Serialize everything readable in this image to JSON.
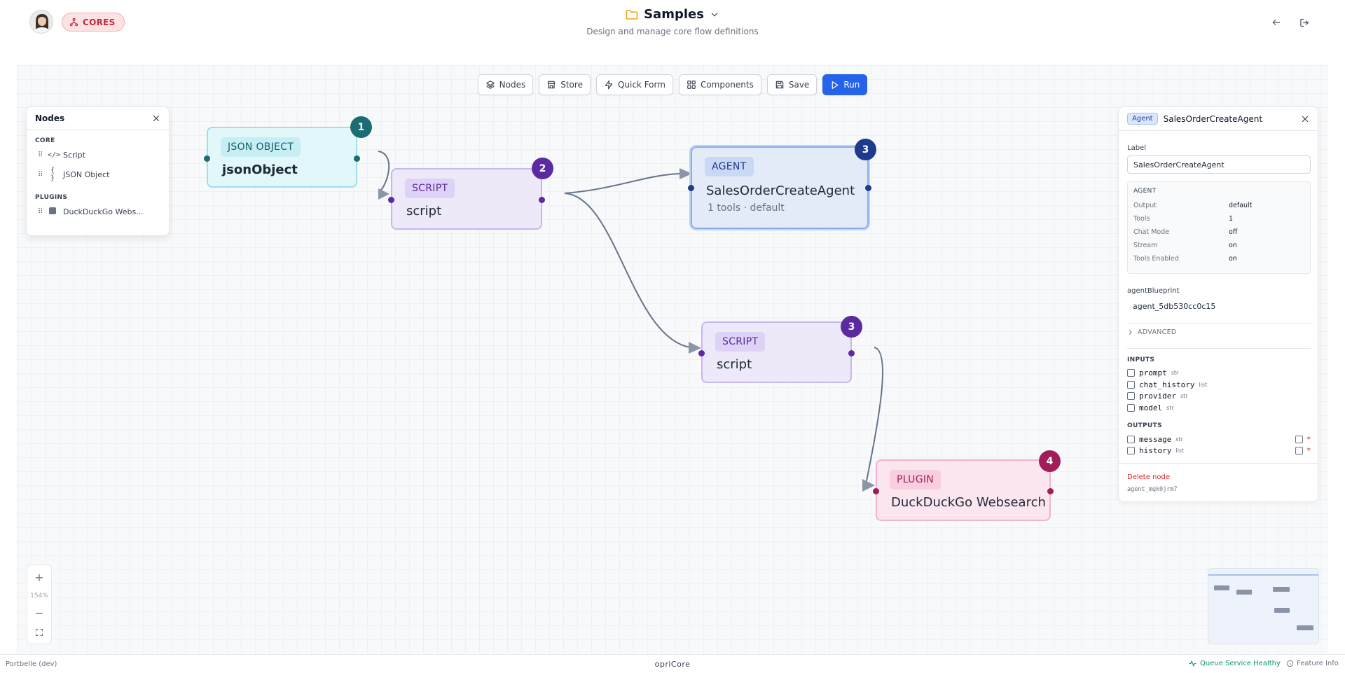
{
  "header": {
    "badge_label": "CORES",
    "title": "Samples",
    "subtitle": "Design and manage core flow definitions"
  },
  "toolbar": {
    "nodes_label": "Nodes",
    "store_label": "Store",
    "quick_form_label": "Quick Form",
    "components_label": "Components",
    "save_label": "Save",
    "run_label": "Run"
  },
  "nodes_panel": {
    "title": "Nodes",
    "core_section": "CORE",
    "core_items": [
      "Script",
      "JSON Object"
    ],
    "core_icons": [
      "</>",
      "{ }"
    ],
    "plugins_section": "PLUGINS",
    "plugin_items": [
      "DuckDuckGo Webs..."
    ]
  },
  "flow_nodes": {
    "json": {
      "tag": "JSON OBJECT",
      "name": "jsonObject",
      "num": "1"
    },
    "script1": {
      "tag": "SCRIPT",
      "name": "script",
      "num": "2"
    },
    "agent": {
      "tag": "AGENT",
      "name": "SalesOrderCreateAgent",
      "sub": "1 tools · default",
      "num": "3"
    },
    "script2": {
      "tag": "SCRIPT",
      "name": "script",
      "num": "3"
    },
    "plugin": {
      "tag": "PLUGIN",
      "name": "DuckDuckGo Websearch",
      "num": "4"
    }
  },
  "props": {
    "badge": "Agent",
    "name": "SalesOrderCreateAgent",
    "label_caption": "Label",
    "label_value": "SalesOrderCreateAgent",
    "box_title": "AGENT",
    "kv": [
      {
        "k": "Output",
        "v": "default"
      },
      {
        "k": "Tools",
        "v": "1"
      },
      {
        "k": "Chat Mode",
        "v": "off"
      },
      {
        "k": "Stream",
        "v": "on"
      },
      {
        "k": "Tools Enabled",
        "v": "on"
      }
    ],
    "blueprint_caption": "agentBlueprint",
    "blueprint_value": "agent_5db530cc0c15",
    "advanced_label": "ADVANCED",
    "inputs_label": "INPUTS",
    "inputs": [
      {
        "name": "prompt",
        "type": "str"
      },
      {
        "name": "chat_history",
        "type": "list"
      },
      {
        "name": "provider",
        "type": "str"
      },
      {
        "name": "model",
        "type": "str"
      }
    ],
    "outputs_label": "OUTPUTS",
    "outputs": [
      {
        "name": "message",
        "type": "str",
        "req": "*"
      },
      {
        "name": "history",
        "type": "list",
        "req": "*"
      }
    ],
    "delete_label": "Delete node",
    "node_id": "agent_mqk0jrm7"
  },
  "zoom": {
    "plus": "+",
    "level": "154%",
    "minus": "−"
  },
  "footer": {
    "left": "Portbelle (dev)",
    "center": "opriCore",
    "queue": "Queue Service Healthy",
    "feature": "Feature Info"
  },
  "colors": {
    "run_button": "#2563eb",
    "json_accent": "#1d6b73",
    "script_accent": "#5b2aa0",
    "agent_accent": "#1e3a8a",
    "plugin_accent": "#a21c5a",
    "cores_badge": "#c2283c",
    "healthy": "#059669",
    "danger": "#dc2626"
  }
}
